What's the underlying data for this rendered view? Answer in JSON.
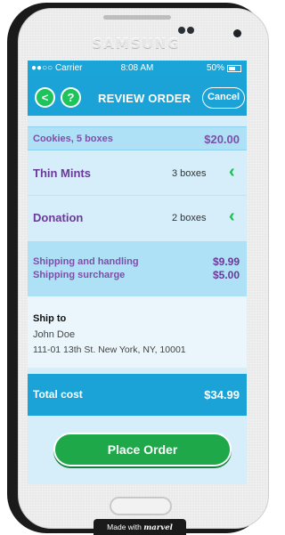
{
  "device": {
    "brand": "SAMSUNG"
  },
  "status_bar": {
    "carrier": "●●○○ Carrier",
    "time": "8:08 AM",
    "battery": "50%"
  },
  "nav": {
    "back_label": "<",
    "help_label": "?",
    "title": "REVIEW ORDER",
    "cancel_label": "Cancel"
  },
  "order": {
    "summary": {
      "label": "Cookies, 5 boxes",
      "amount": "$20.00"
    },
    "items": [
      {
        "name": "Thin Mints",
        "quantity": "3 boxes"
      },
      {
        "name": "Donation",
        "quantity": "2 boxes"
      }
    ],
    "shipping": [
      {
        "label": "Shipping and handling",
        "amount": "$9.99"
      },
      {
        "label": "Shipping surcharge",
        "amount": "$5.00"
      }
    ],
    "ship_to": {
      "heading": "Ship to",
      "name": "John Doe",
      "address": "111-01 13th St. New York, NY, 10001"
    },
    "total": {
      "label": "Total cost",
      "amount": "$34.99"
    }
  },
  "actions": {
    "place_order_label": "Place Order"
  },
  "footer_badge": {
    "prefix": "Made with",
    "mark": "marvel"
  },
  "colors": {
    "accent_blue": "#1ba3d8",
    "green": "#1ea84a",
    "purple": "#6a3a99"
  }
}
